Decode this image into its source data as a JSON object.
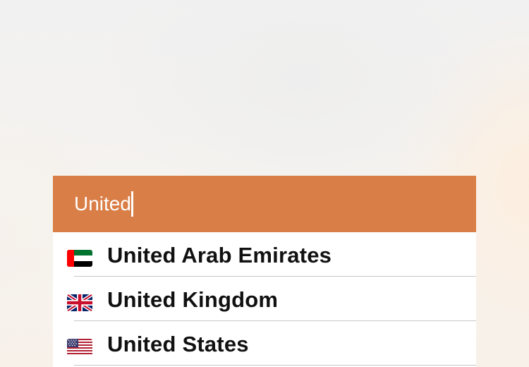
{
  "search": {
    "query": "United"
  },
  "results": [
    {
      "name": "United Arab Emirates",
      "flag_icon": "uae-flag-icon"
    },
    {
      "name": "United Kingdom",
      "flag_icon": "uk-flag-icon"
    },
    {
      "name": "United States",
      "flag_icon": "us-flag-icon"
    }
  ],
  "colors": {
    "search_bar": "#d97e46",
    "text": "#111111",
    "separator": "#c8c7cc"
  }
}
